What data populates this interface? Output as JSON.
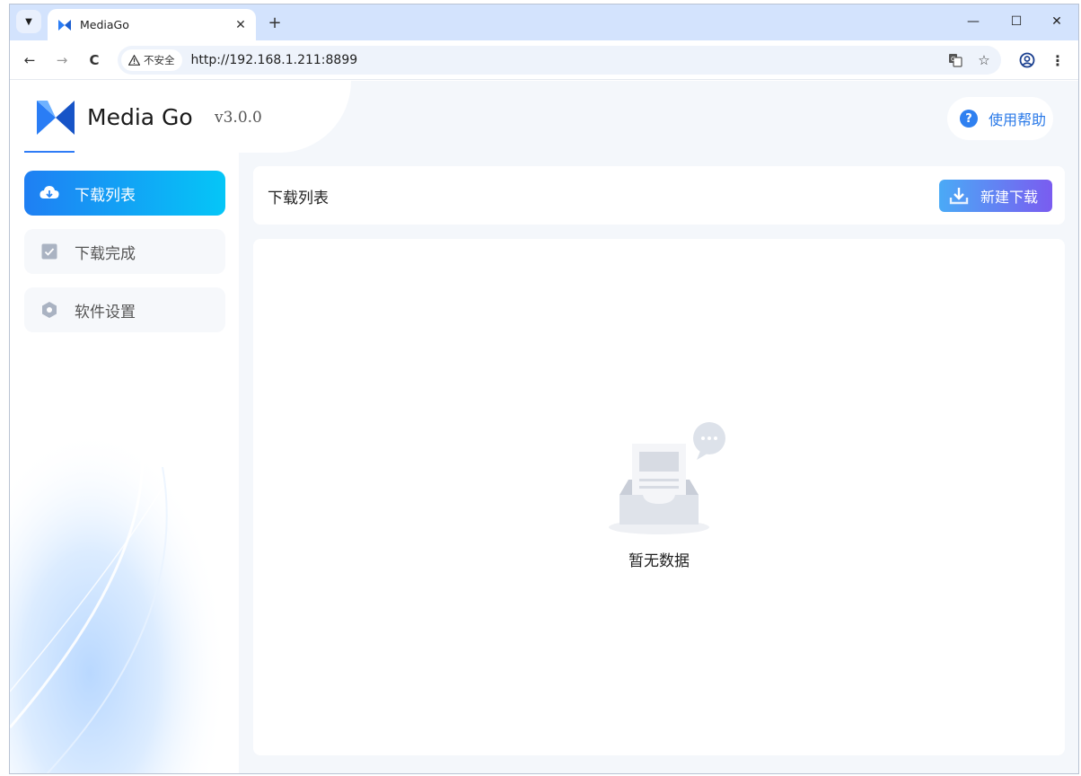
{
  "browser": {
    "tab": {
      "title": "MediaGo"
    },
    "new_tab_symbol": "+",
    "tab_close_symbol": "✕",
    "window_controls": {
      "minimize": "—",
      "maximize": "☐",
      "close": "✕"
    },
    "nav": {
      "back": "←",
      "forward": "→",
      "reload": "C"
    },
    "security_label": "不安全",
    "url": "http://192.168.1.211:8899",
    "icons": [
      "tab-search-icon",
      "mediago-favicon-icon",
      "warning-icon",
      "translate-icon",
      "bookmark-star-icon",
      "profile-icon",
      "more-menu-icon"
    ]
  },
  "app": {
    "brand_name": "Media Go",
    "version": "v3.0.0",
    "help_label": "使用帮助",
    "sidebar": {
      "items": [
        {
          "label": "下载列表",
          "icon": "cloud-download-icon",
          "active": true
        },
        {
          "label": "下载完成",
          "icon": "checkbox-icon",
          "active": false
        },
        {
          "label": "软件设置",
          "icon": "hexagon-settings-icon",
          "active": false
        }
      ]
    },
    "main": {
      "page_title": "下载列表",
      "new_download_label": "新建下载",
      "empty_text": "暂无数据"
    },
    "colors": {
      "accent": "#2f7cf6",
      "active_gradient_start": "#1f7ff3",
      "active_gradient_end": "#05c6f7",
      "button_gradient_start": "#4aaaf6",
      "button_gradient_end": "#7a5cf0"
    }
  }
}
